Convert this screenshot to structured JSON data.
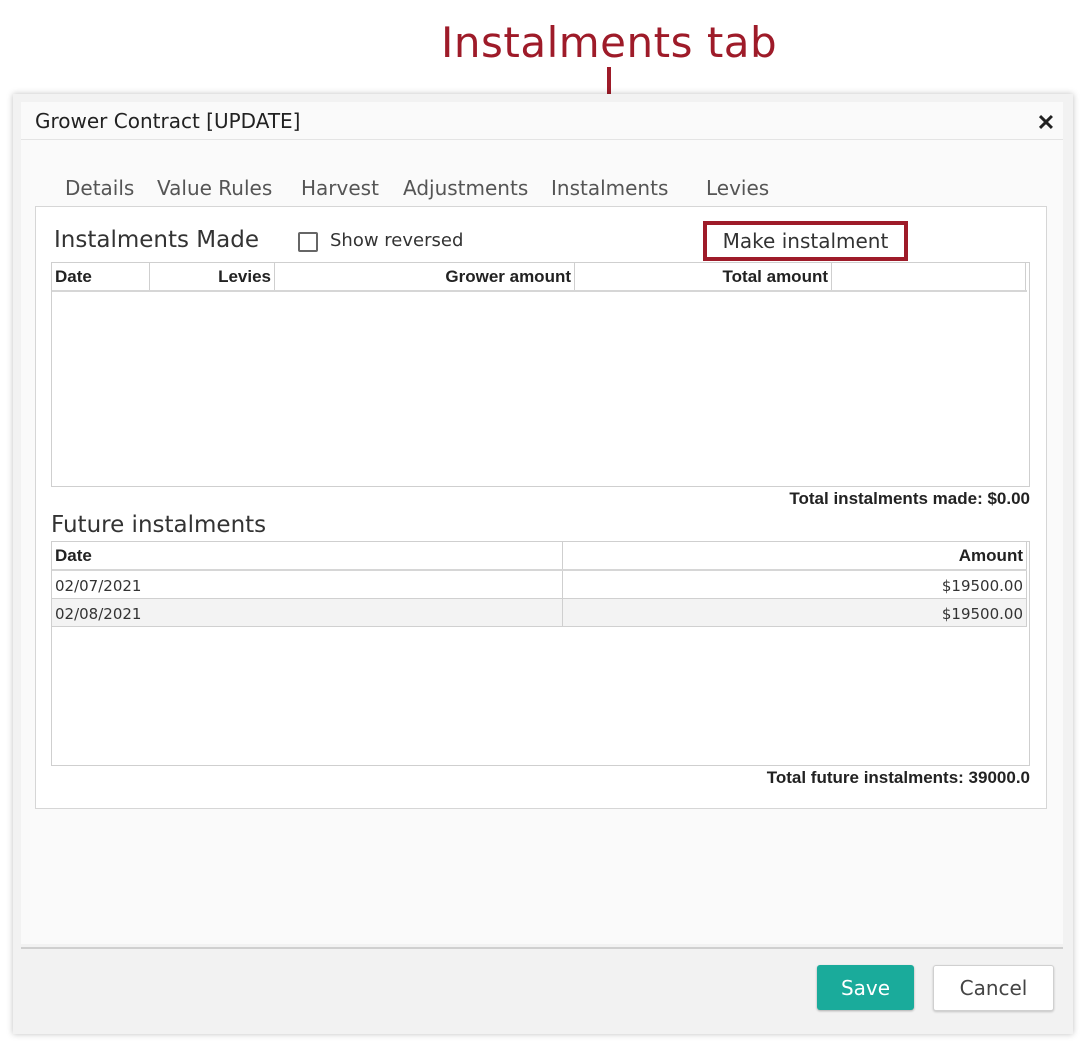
{
  "annotation": {
    "label": "Instalments tab"
  },
  "dialog": {
    "title": "Grower Contract [UPDATE]",
    "close_icon": "close-icon"
  },
  "tabs": [
    {
      "label": "Details",
      "active": false
    },
    {
      "label": "Value Rules",
      "active": false
    },
    {
      "label": "Harvest",
      "active": false
    },
    {
      "label": "Adjustments",
      "active": false
    },
    {
      "label": "Instalments",
      "active": true
    },
    {
      "label": "Levies",
      "active": false
    }
  ],
  "instalments_made": {
    "title": "Instalments Made",
    "show_reversed_label": "Show reversed",
    "show_reversed_checked": false,
    "make_button_label": "Make instalment",
    "columns": [
      "Date",
      "Levies",
      "Grower amount",
      "Total amount",
      ""
    ],
    "rows": [],
    "total_label": "Total instalments made: $0.00"
  },
  "future_instalments": {
    "title": "Future instalments",
    "columns": [
      "Date",
      "Amount"
    ],
    "rows": [
      {
        "date": "02/07/2021",
        "amount": "$19500.00"
      },
      {
        "date": "02/08/2021",
        "amount": "$19500.00"
      }
    ],
    "total_label": "Total future instalments: 39000.0"
  },
  "footer": {
    "save_label": "Save",
    "cancel_label": "Cancel"
  },
  "colors": {
    "annotation": "#9e1b29",
    "active_tab_underline": "#1bbfc4",
    "save_button": "#1aab9b"
  }
}
